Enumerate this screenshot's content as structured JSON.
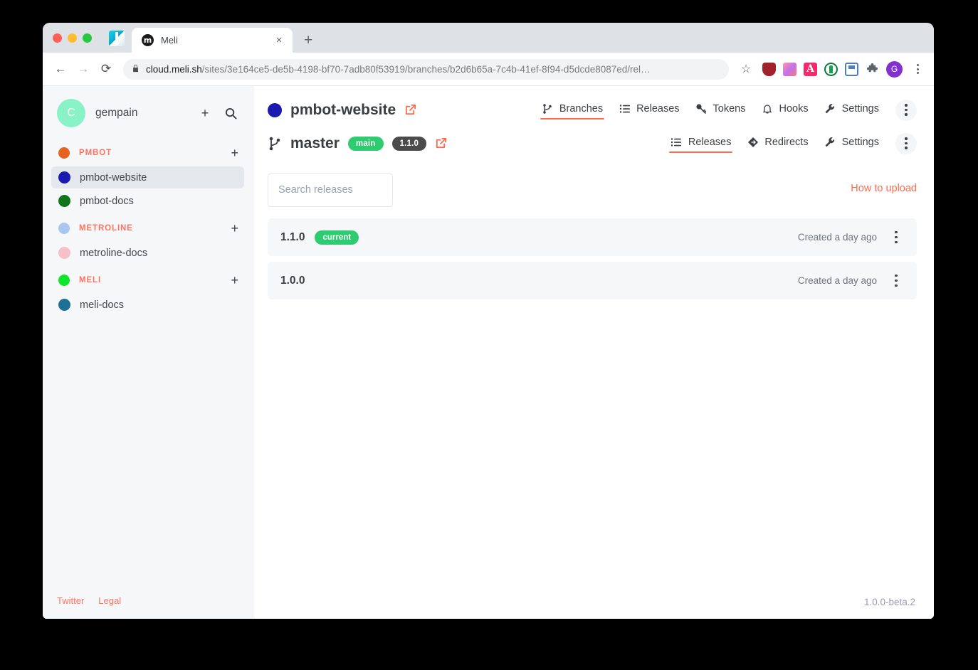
{
  "browser": {
    "tab": {
      "title": "Meli",
      "favicon_letter": "m",
      "close_label": "×"
    },
    "new_tab_label": "+",
    "nav": {
      "back": "←",
      "forward": "→",
      "reload": "⟳"
    },
    "omnibox": {
      "lock_icon": "lock-icon",
      "url_host": "cloud.meli.sh",
      "url_path": "/sites/3e164ce5-de5b-4198-bf70-7adb80f53919/branches/b2d6b65a-7c4b-41ef-8f94-d5dcde8087ed/rel…",
      "star_icon": "☆"
    },
    "extensions": [
      {
        "name": "shield-extension-icon",
        "glyph": "Ⓤ"
      },
      {
        "name": "gradient-extension-icon",
        "glyph": ""
      },
      {
        "name": "letter-a-extension-icon",
        "glyph": "A"
      },
      {
        "name": "tree-extension-icon",
        "glyph": ""
      },
      {
        "name": "floppy-extension-icon",
        "glyph": ""
      },
      {
        "name": "puzzle-extension-icon",
        "glyph": "❖"
      }
    ],
    "profile_initial": "G"
  },
  "sidebar": {
    "account": {
      "initial": "C",
      "name": "gempain",
      "add_label": "+",
      "search_icon": "search-icon"
    },
    "groups": [
      {
        "name": "PMBOT",
        "color": "#e8621f",
        "add_label": "+",
        "sites": [
          {
            "name": "pmbot-website",
            "color": "#1a1ab0",
            "active": true
          },
          {
            "name": "pmbot-docs",
            "color": "#11751a",
            "active": false
          }
        ]
      },
      {
        "name": "METROLINE",
        "color": "#a8c6f0",
        "add_label": "+",
        "sites": [
          {
            "name": "metroline-docs",
            "color": "#f7bfc9",
            "active": false
          }
        ]
      },
      {
        "name": "MELI",
        "color": "#11e62e",
        "add_label": "+",
        "sites": [
          {
            "name": "meli-docs",
            "color": "#1f6f96",
            "active": false
          }
        ]
      }
    ],
    "footer_links": [
      {
        "label": "Twitter"
      },
      {
        "label": "Legal"
      }
    ]
  },
  "main": {
    "site": {
      "name": "pmbot-website",
      "dot_color": "#1a1ab0",
      "external_link_icon": "external-link-icon"
    },
    "site_nav": [
      {
        "label": "Branches",
        "icon": "branch-icon",
        "active": true
      },
      {
        "label": "Releases",
        "icon": "list-icon",
        "active": false
      },
      {
        "label": "Tokens",
        "icon": "key-icon",
        "active": false
      },
      {
        "label": "Hooks",
        "icon": "bell-icon",
        "active": false
      },
      {
        "label": "Settings",
        "icon": "wrench-icon",
        "active": false
      }
    ],
    "branch": {
      "icon": "branch-icon",
      "name": "master",
      "badges": [
        {
          "label": "main",
          "style": "green"
        },
        {
          "label": "1.1.0",
          "style": "dark"
        }
      ],
      "external_link_icon": "external-link-icon"
    },
    "branch_nav": [
      {
        "label": "Releases",
        "icon": "list-icon",
        "active": true
      },
      {
        "label": "Redirects",
        "icon": "redirect-icon",
        "active": false
      },
      {
        "label": "Settings",
        "icon": "wrench-icon",
        "active": false
      }
    ],
    "search": {
      "value": "",
      "placeholder": "Search releases"
    },
    "how_to_upload": "How to upload",
    "releases": [
      {
        "version": "1.1.0",
        "badge": "current",
        "created": "Created a day ago"
      },
      {
        "version": "1.0.0",
        "badge": "",
        "created": "Created a day ago"
      }
    ],
    "footer_version": "1.0.0-beta.2"
  },
  "colors": {
    "accent": "#ff6a4d",
    "green": "#2ecc71",
    "dark_badge": "#4b4b4b",
    "sidebar_bg": "#f5f7f9",
    "row_bg": "#f5f7f9"
  }
}
